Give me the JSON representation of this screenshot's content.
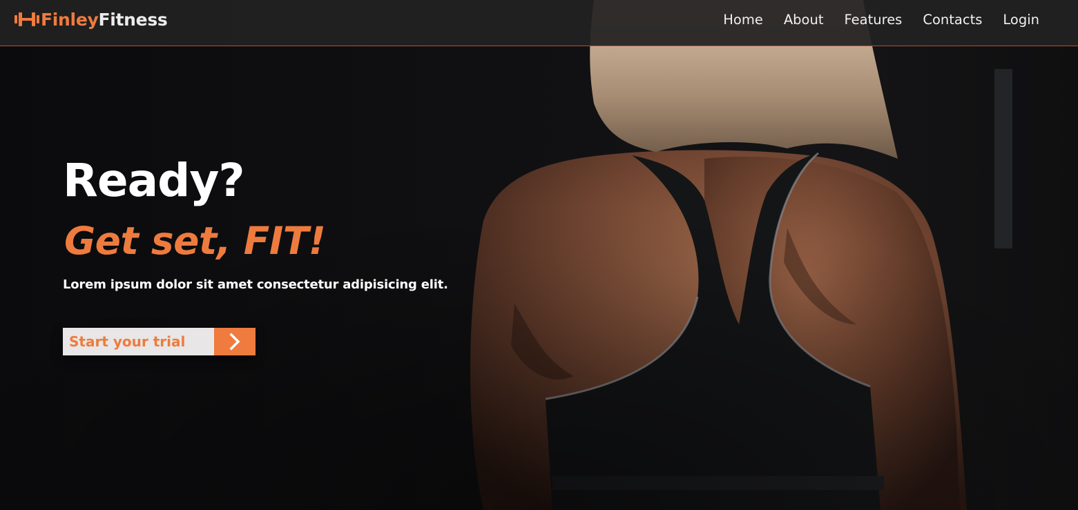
{
  "brand": {
    "part1": "Finley",
    "part2": "Fitness",
    "logo_icon": "dumbbell-icon"
  },
  "nav": {
    "items": [
      {
        "label": "Home"
      },
      {
        "label": "About"
      },
      {
        "label": "Features"
      },
      {
        "label": "Contacts"
      },
      {
        "label": "Login"
      }
    ]
  },
  "hero": {
    "title": "Ready?",
    "subtitle": "Get set, FIT!",
    "text": "Lorem ipsum dolor sit amet consectetur adipisicing elit.",
    "cta_label": "Start your trial",
    "cta_icon": "chevron-right-icon",
    "background": "photo of athlete's back in a black sports bra"
  },
  "colors": {
    "accent": "#ef7b3e",
    "nav_bg": "#222121",
    "nav_border": "#b0503a",
    "hero_bg": "#0f0f11",
    "text_light": "#ffffff",
    "cta_bg": "#e8e6e6"
  }
}
